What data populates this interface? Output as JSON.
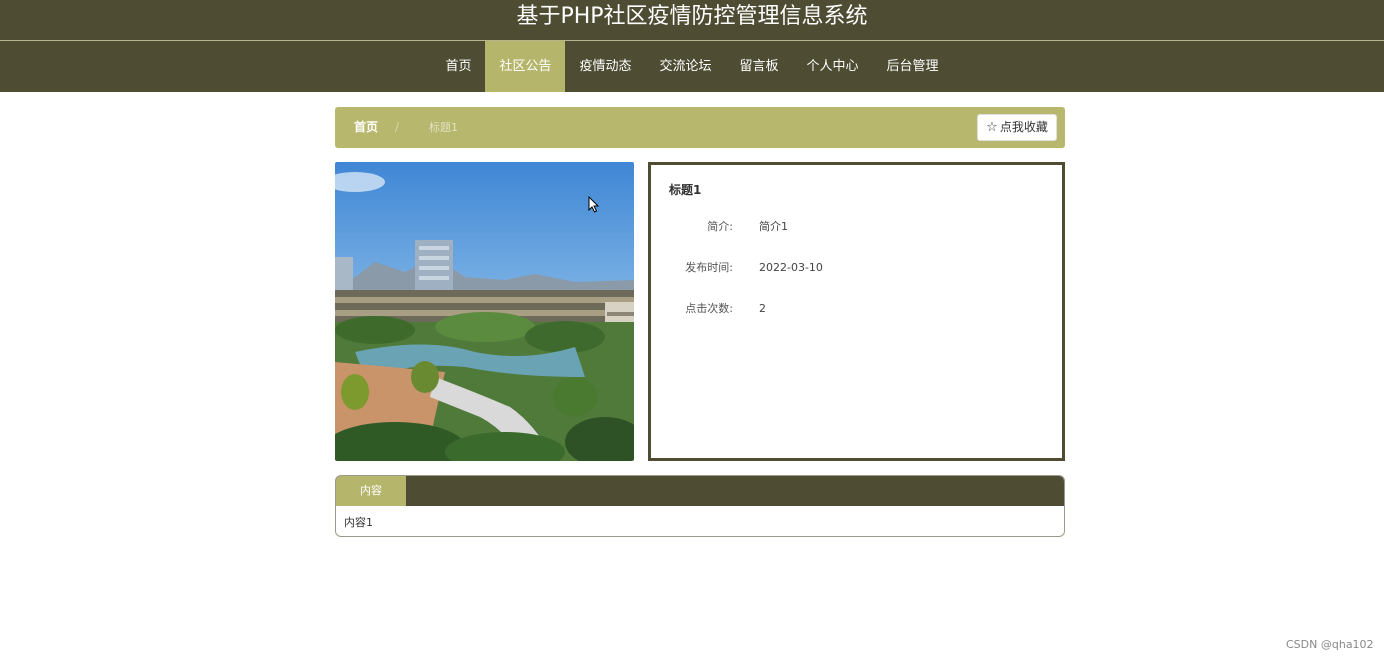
{
  "header": {
    "site_title": "基于PHP社区疫情防控管理信息系统"
  },
  "nav": {
    "items": [
      {
        "label": "首页",
        "active": false
      },
      {
        "label": "社区公告",
        "active": true
      },
      {
        "label": "疫情动态",
        "active": false
      },
      {
        "label": "交流论坛",
        "active": false
      },
      {
        "label": "留言板",
        "active": false
      },
      {
        "label": "个人中心",
        "active": false
      },
      {
        "label": "后台管理",
        "active": false
      }
    ]
  },
  "breadcrumb": {
    "home": "首页",
    "separator": "/",
    "current": "标题1"
  },
  "favorite": {
    "label": "点我收藏",
    "icon": "star-outline-icon"
  },
  "detail": {
    "title": "标题1",
    "rows": [
      {
        "label": "简介:",
        "value": "简介1"
      },
      {
        "label": "发布时间:",
        "value": "2022-03-10"
      },
      {
        "label": "点击次数:",
        "value": "2"
      }
    ]
  },
  "content": {
    "tab_label": "内容",
    "text": "内容1"
  },
  "watermark": "CSDN @qha102",
  "colors": {
    "header_bg": "#4e4c33",
    "accent": "#b5b66c",
    "white": "#ffffff"
  }
}
